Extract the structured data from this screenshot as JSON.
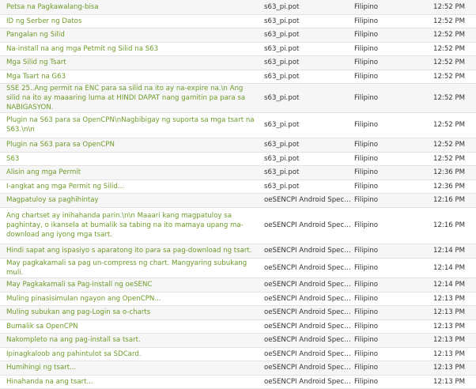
{
  "colors": {
    "link": "#6f9b2a",
    "text": "#333333",
    "row_alt": "#f6f6f6",
    "border": "#e3e3e3"
  },
  "rows": [
    {
      "source": "Petsa na Pagkawalang-bisa",
      "file": "s63_pi.pot",
      "language": "Filipino",
      "time": "12:52 PM"
    },
    {
      "source": "ID ng Serber ng Datos",
      "file": "s63_pi.pot",
      "language": "Filipino",
      "time": "12:52 PM"
    },
    {
      "source": "Pangalan ng Silid",
      "file": "s63_pi.pot",
      "language": "Filipino",
      "time": "12:52 PM"
    },
    {
      "source": "Na-install na ang mga Petmit ng Silid na S63",
      "file": "s63_pi.pot",
      "language": "Filipino",
      "time": "12:52 PM"
    },
    {
      "source": "Mga Silid ng Tsart",
      "file": "s63_pi.pot",
      "language": "Filipino",
      "time": "12:52 PM"
    },
    {
      "source": "Mga Tsart na G63",
      "file": "s63_pi.pot",
      "language": "Filipino",
      "time": "12:52 PM"
    },
    {
      "source": "SSE 25..Ang permit na ENC para sa silid na ito ay na-expire na.\\n Ang silid na ito ay maaaring luma at HINDI DAPAT nang gamitin pa para sa NABIGASYON.",
      "file": "s63_pi.pot",
      "language": "Filipino",
      "time": "12:52 PM"
    },
    {
      "source": "Plugin na S63 para sa OpenCPN\\nNagbibigay ng suporta sa mga tsart na S63.\\n\\n",
      "file": "s63_pi.pot",
      "language": "Filipino",
      "time": "12:52 PM"
    },
    {
      "source": "Plugin na S63 para sa OpenCPN",
      "file": "s63_pi.pot",
      "language": "Filipino",
      "time": "12:52 PM"
    },
    {
      "source": "S63",
      "file": "s63_pi.pot",
      "language": "Filipino",
      "time": "12:52 PM"
    },
    {
      "source": "Alisin ang mga Permit",
      "file": "s63_pi.pot",
      "language": "Filipino",
      "time": "12:36 PM"
    },
    {
      "source": "I-angkat ang mga Permit ng Silid...",
      "file": "s63_pi.pot",
      "language": "Filipino",
      "time": "12:36 PM"
    },
    {
      "source": "Magpatuloy sa paghihintay",
      "file": "oeSENCPI Android Specifi...",
      "language": "Filipino",
      "time": "12:16 PM"
    },
    {
      "source": "Ang chartset ay inihahanda parin.\\n\\n Maaari kang magpatuloy sa paghintay, o ikansela at bumalik sa tabing na ito mamaya upang ma-download ang iyong mga tsart.",
      "file": "oeSENCPI Android Specifi...",
      "language": "Filipino",
      "time": "12:16 PM"
    },
    {
      "source": "Hindi sapat ang ispasiyo s aparatong ito para sa pag-download ng tsart.",
      "file": "oeSENCPI Android Specifi...",
      "language": "Filipino",
      "time": "12:14 PM"
    },
    {
      "source": "May pagkakamali sa pag un-compress ng chart. Mangyaring subukang muli.",
      "file": "oeSENCPI Android Specifi...",
      "language": "Filipino",
      "time": "12:14 PM"
    },
    {
      "source": "May Pagkakamali sa Pag-install ng oeSENC",
      "file": "oeSENCPI Android Specifi...",
      "language": "Filipino",
      "time": "12:14 PM"
    },
    {
      "source": "Muling pinasisimulan ngayon ang OpenCPN...",
      "file": "oeSENCPI Android Specifi...",
      "language": "Filipino",
      "time": "12:13 PM"
    },
    {
      "source": "Muling subukan ang pag-Login sa o-charts",
      "file": "oeSENCPI Android Specifi...",
      "language": "Filipino",
      "time": "12:13 PM"
    },
    {
      "source": "Bumalik sa OpenCPN",
      "file": "oeSENCPI Android Specifi...",
      "language": "Filipino",
      "time": "12:13 PM"
    },
    {
      "source": "Nakompleto na ang pag-install sa tsart.",
      "file": "oeSENCPI Android Specifi...",
      "language": "Filipino",
      "time": "12:13 PM"
    },
    {
      "source": "Ipinagkaloob ang pahintulot sa SDCard.",
      "file": "oeSENCPI Android Specifi...",
      "language": "Filipino",
      "time": "12:13 PM"
    },
    {
      "source": "Humihingi ng tsart...",
      "file": "oeSENCPI Android Specifi...",
      "language": "Filipino",
      "time": "12:13 PM"
    },
    {
      "source": "Hinahanda na ang tsart...",
      "file": "oeSENCPI Android Specifi...",
      "language": "Filipino",
      "time": "12:13 PM"
    }
  ]
}
